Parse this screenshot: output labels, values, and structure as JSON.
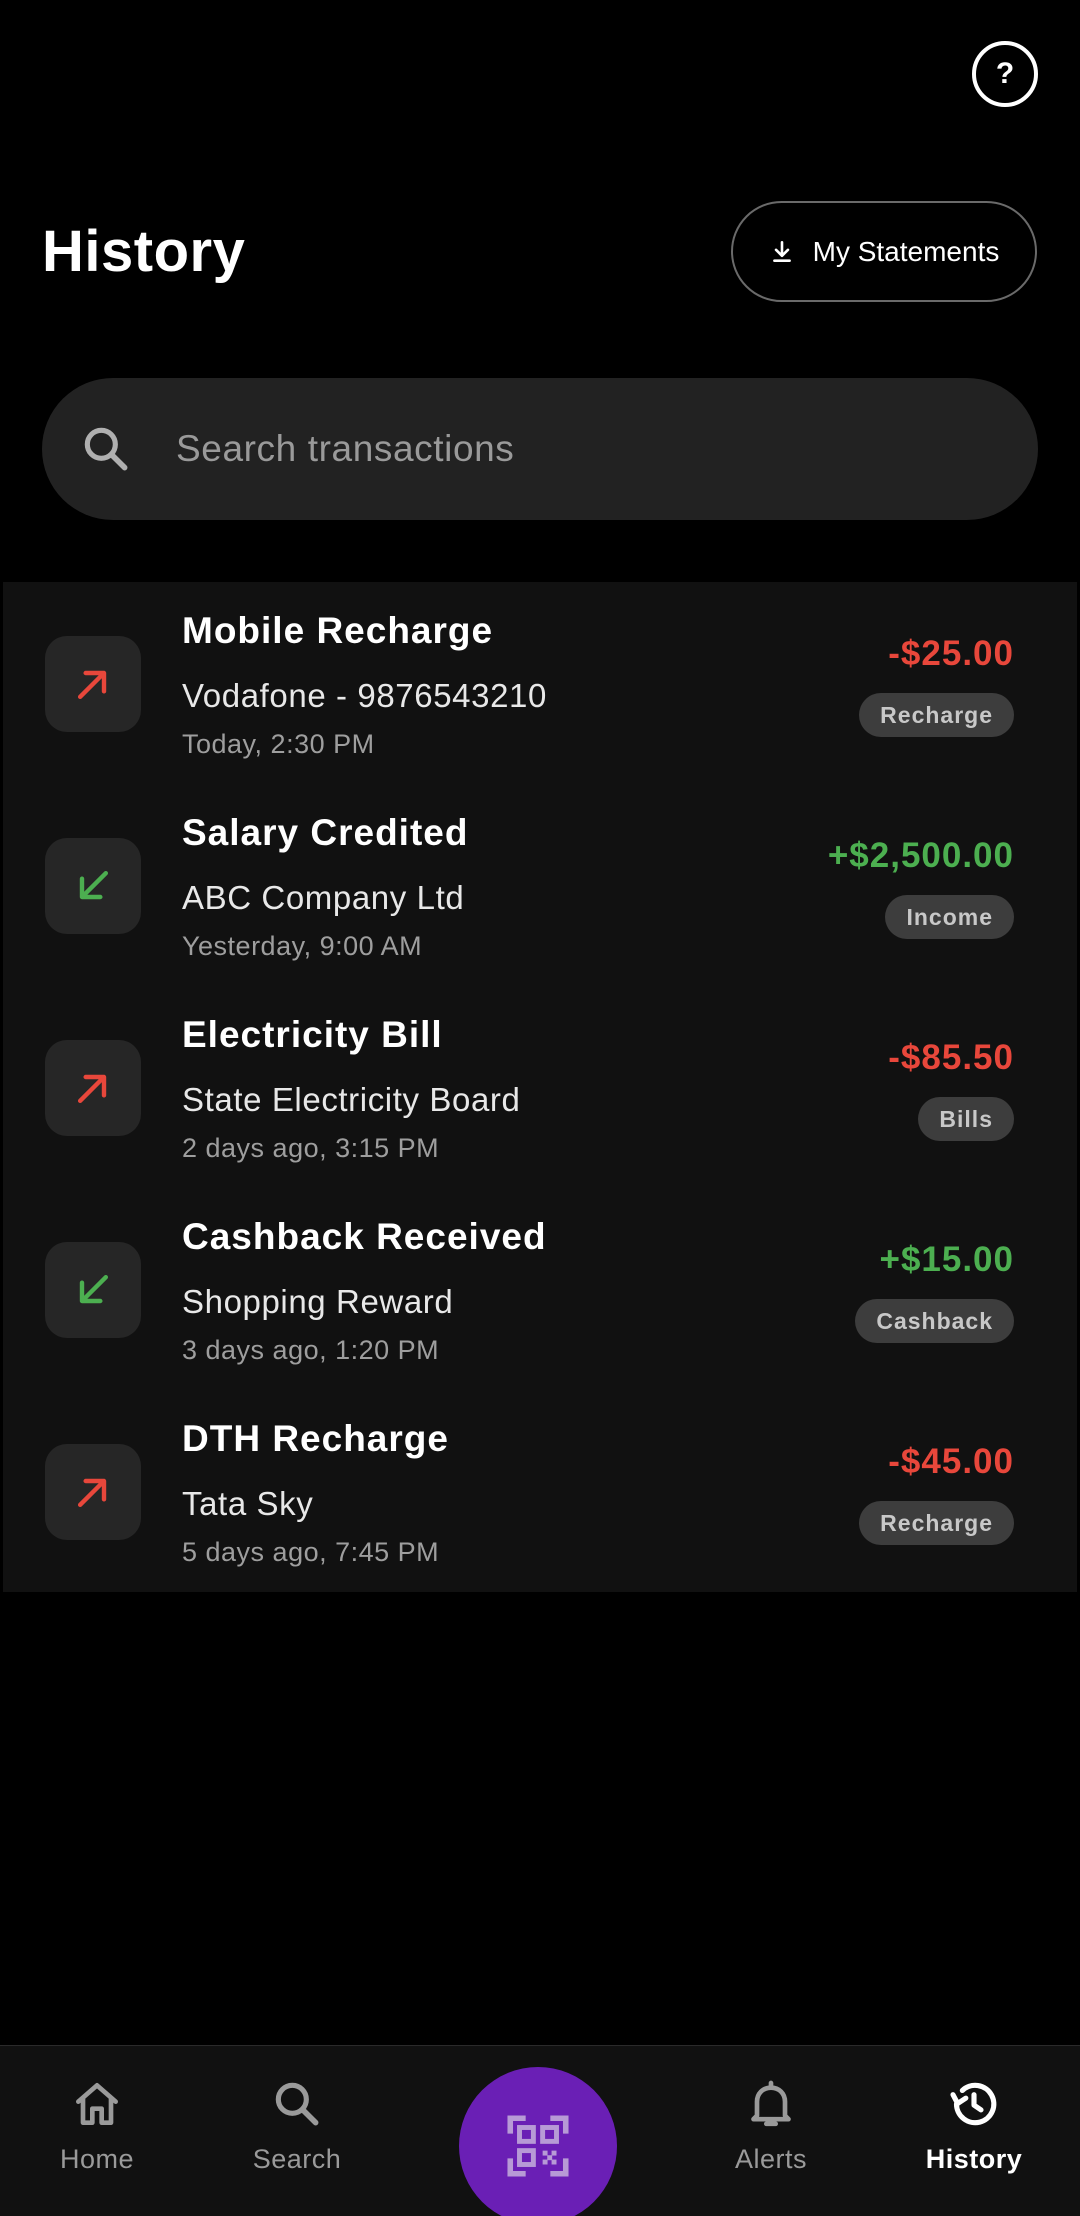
{
  "header": {
    "help_label": "?",
    "title": "History",
    "statements_label": "My Statements"
  },
  "search": {
    "placeholder": "Search transactions"
  },
  "colors": {
    "debit": "#e8473b",
    "credit": "#4caf50",
    "accent": "#6a1fb5"
  },
  "transactions": [
    {
      "title": "Mobile Recharge",
      "subtitle": "Vodafone - 9876543210",
      "time": "Today, 2:30 PM",
      "amount": "-$25.00",
      "tag": "Recharge",
      "direction": "out",
      "icon": "arrow-up-right-icon"
    },
    {
      "title": "Salary Credited",
      "subtitle": "ABC Company Ltd",
      "time": "Yesterday, 9:00 AM",
      "amount": "+$2,500.00",
      "tag": "Income",
      "direction": "in",
      "icon": "arrow-down-left-icon"
    },
    {
      "title": "Electricity Bill",
      "subtitle": "State Electricity Board",
      "time": "2 days ago, 3:15 PM",
      "amount": "-$85.50",
      "tag": "Bills",
      "direction": "out",
      "icon": "arrow-up-right-icon"
    },
    {
      "title": "Cashback Received",
      "subtitle": "Shopping Reward",
      "time": "3 days ago, 1:20 PM",
      "amount": "+$15.00",
      "tag": "Cashback",
      "direction": "in",
      "icon": "arrow-down-left-icon"
    },
    {
      "title": "DTH Recharge",
      "subtitle": "Tata Sky",
      "time": "5 days ago, 7:45 PM",
      "amount": "-$45.00",
      "tag": "Recharge",
      "direction": "out",
      "icon": "arrow-up-right-icon"
    }
  ],
  "nav": {
    "items": [
      {
        "label": "Home",
        "icon": "home-icon"
      },
      {
        "label": "Search",
        "icon": "search-icon"
      },
      {
        "label": "Alerts",
        "icon": "bell-icon"
      },
      {
        "label": "History",
        "icon": "history-icon"
      }
    ],
    "active": "History",
    "center_icon": "qr-code-icon"
  }
}
